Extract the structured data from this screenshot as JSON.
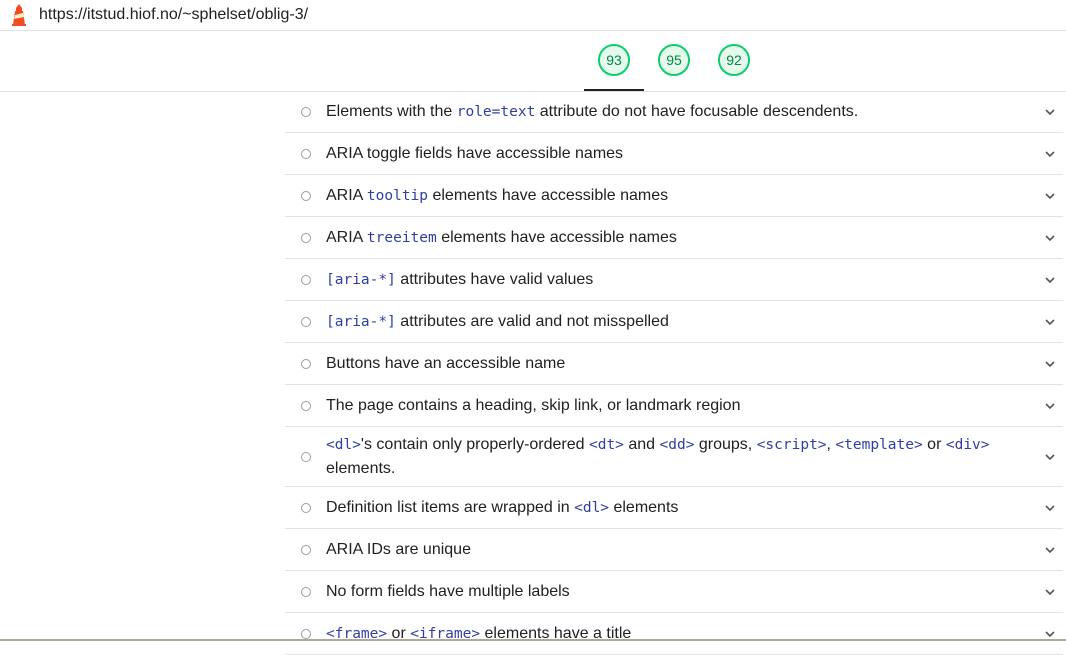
{
  "address_bar": {
    "url": "https://itstud.hiof.no/~sphelset/oblig-3/",
    "icon": "lighthouse-icon"
  },
  "scores": [
    {
      "value": "93",
      "color": "#0cce6b"
    },
    {
      "value": "95",
      "color": "#0cce6b"
    },
    {
      "value": "92",
      "color": "#0cce6b"
    }
  ],
  "audits": [
    {
      "parts": [
        {
          "t": "Elements with the "
        },
        {
          "c": "role=text"
        },
        {
          "t": " attribute do not have focusable descendents."
        }
      ]
    },
    {
      "parts": [
        {
          "t": "ARIA toggle fields have accessible names"
        }
      ]
    },
    {
      "parts": [
        {
          "t": "ARIA "
        },
        {
          "c": "tooltip"
        },
        {
          "t": " elements have accessible names"
        }
      ]
    },
    {
      "parts": [
        {
          "t": "ARIA "
        },
        {
          "c": "treeitem"
        },
        {
          "t": " elements have accessible names"
        }
      ]
    },
    {
      "parts": [
        {
          "c": "[aria-*]"
        },
        {
          "t": " attributes have valid values"
        }
      ]
    },
    {
      "parts": [
        {
          "c": "[aria-*]"
        },
        {
          "t": " attributes are valid and not misspelled"
        }
      ]
    },
    {
      "parts": [
        {
          "t": "Buttons have an accessible name"
        }
      ]
    },
    {
      "parts": [
        {
          "t": "The page contains a heading, skip link, or landmark region"
        }
      ]
    },
    {
      "tall": true,
      "parts": [
        {
          "c": "<dl>"
        },
        {
          "t": "'s contain only properly-ordered "
        },
        {
          "c": "<dt>"
        },
        {
          "t": " and "
        },
        {
          "c": "<dd>"
        },
        {
          "t": " groups, "
        },
        {
          "c": "<script>"
        },
        {
          "t": ", "
        },
        {
          "c": "<template>"
        },
        {
          "t": " or "
        },
        {
          "c": "<div>"
        },
        {
          "t": " elements."
        }
      ]
    },
    {
      "parts": [
        {
          "t": "Definition list items are wrapped in "
        },
        {
          "c": "<dl>"
        },
        {
          "t": " elements"
        }
      ]
    },
    {
      "parts": [
        {
          "t": "ARIA IDs are unique"
        }
      ]
    },
    {
      "parts": [
        {
          "t": "No form fields have multiple labels"
        }
      ]
    },
    {
      "parts": [
        {
          "c": "<frame>"
        },
        {
          "t": " or "
        },
        {
          "c": "<iframe>"
        },
        {
          "t": " elements have a title"
        }
      ]
    }
  ]
}
